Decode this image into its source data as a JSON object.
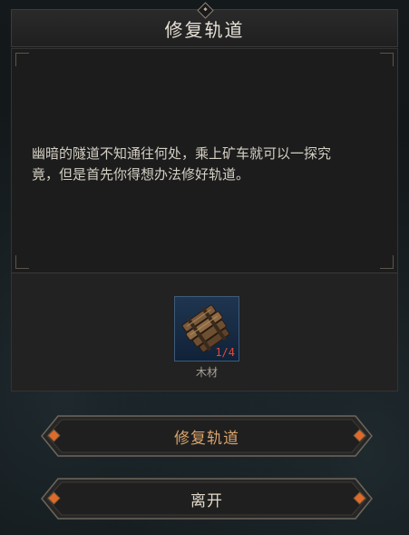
{
  "dialog": {
    "title": "修复轨道",
    "description_line1": "幽暗的隧道不知通往何处，乘上矿车就可以一探究",
    "description_line2": "竟，但是首先你得想办法修好轨道。"
  },
  "required_item": {
    "name": "木材",
    "count": "1/4",
    "icon": "wood-planks-icon"
  },
  "buttons": {
    "repair_label": "修复轨道",
    "leave_label": "离开"
  },
  "colors": {
    "accent_orange": "#d9a36b",
    "count_red": "#e34a3a",
    "gem": "#e06a2a"
  }
}
